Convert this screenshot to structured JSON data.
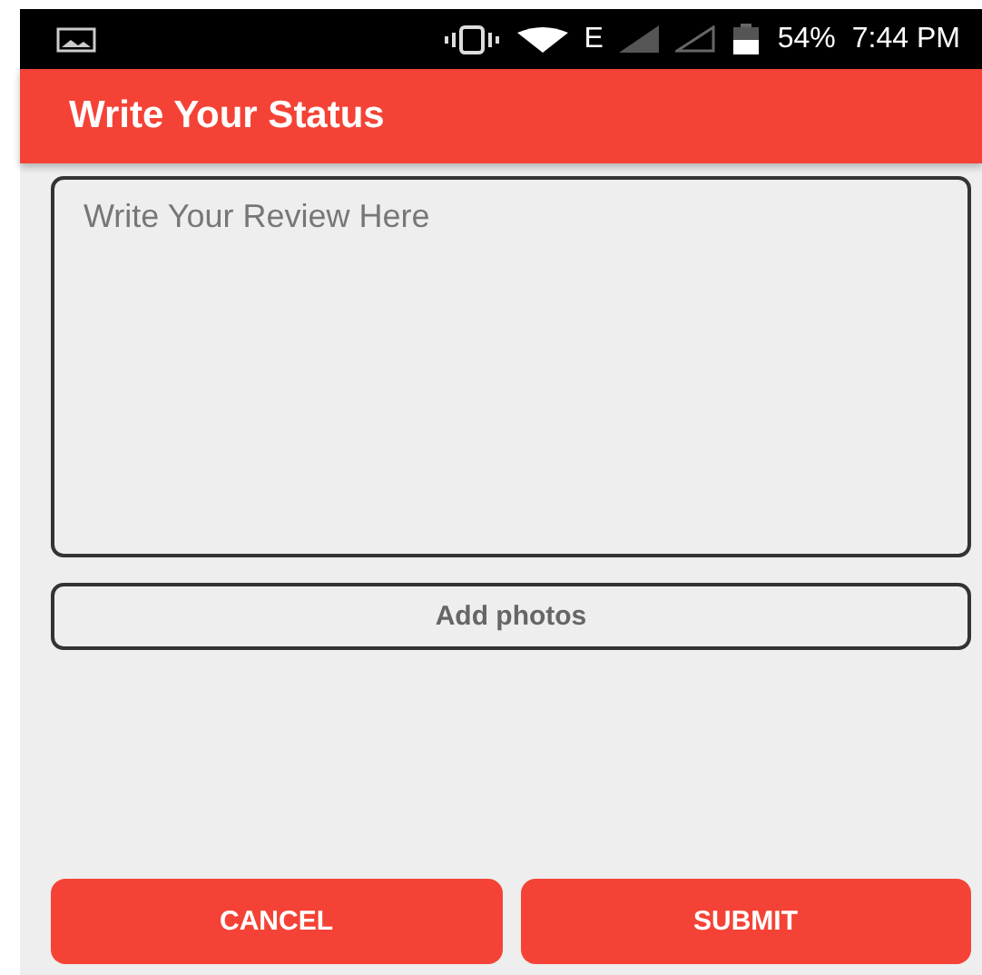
{
  "status_bar": {
    "network": "E",
    "battery": "54%",
    "time": "7:44 PM"
  },
  "app_bar": {
    "title": "Write Your Status"
  },
  "review_field": {
    "placeholder": "Write Your Review Here"
  },
  "add_photos_button": {
    "label": "Add photos"
  },
  "buttons": [
    {
      "label": "CANCEL"
    },
    {
      "label": "SUBMIT"
    }
  ]
}
